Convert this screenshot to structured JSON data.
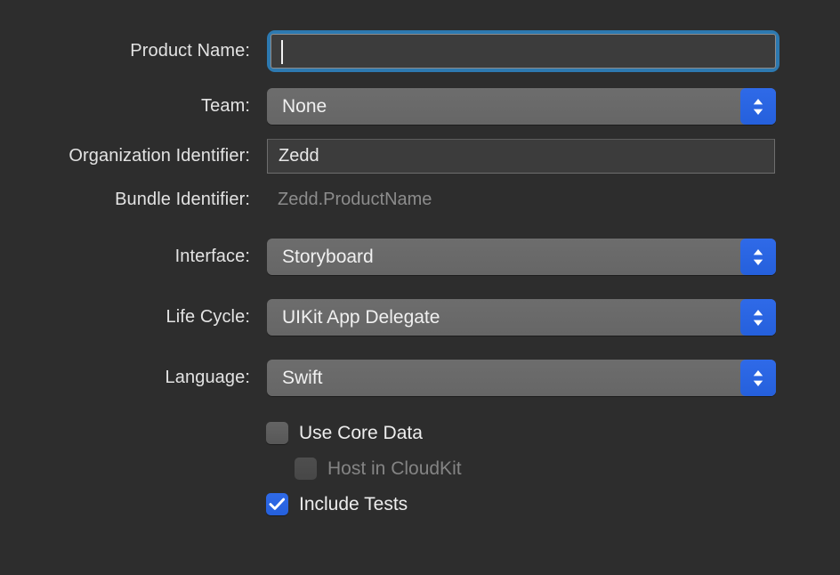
{
  "dialog": {
    "name": "new-project-options",
    "background_color": "#2d2d2d",
    "accent_color": "#2560dc",
    "focus_ring_color": "#2d79b0"
  },
  "fields": {
    "product_name": {
      "label": "Product Name:",
      "value": "",
      "placeholder": ""
    },
    "team": {
      "label": "Team:",
      "value": "None"
    },
    "organization_identifier": {
      "label": "Organization Identifier:",
      "value": "Zedd"
    },
    "bundle_identifier": {
      "label": "Bundle Identifier:",
      "value": "Zedd.ProductName"
    },
    "interface": {
      "label": "Interface:",
      "value": "Storyboard"
    },
    "life_cycle": {
      "label": "Life Cycle:",
      "value": "UIKit App Delegate"
    },
    "language": {
      "label": "Language:",
      "value": "Swift"
    }
  },
  "checkboxes": {
    "use_core_data": {
      "label": "Use Core Data",
      "checked": false,
      "enabled": true
    },
    "host_in_cloudkit": {
      "label": "Host in CloudKit",
      "checked": false,
      "enabled": false
    },
    "include_tests": {
      "label": "Include Tests",
      "checked": true,
      "enabled": true
    }
  }
}
